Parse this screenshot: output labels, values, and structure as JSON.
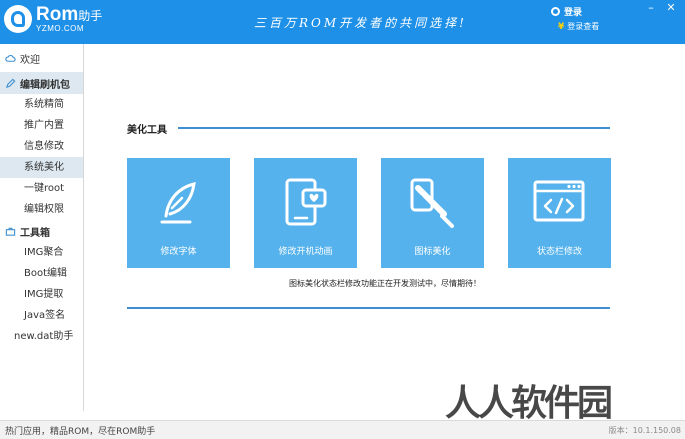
{
  "titlebar": {
    "logo_name": "Rom",
    "logo_name_suffix": "助手",
    "logo_domain": "YZMO.COM",
    "slogan": "三百万ROM开发者的共同选择!",
    "login_label": "登录",
    "gift_label": "登录查看",
    "min_button": "–",
    "close_button": "✕"
  },
  "sidebar": {
    "welcome": "欢迎",
    "group_edit": "编辑刷机包",
    "edit_items": [
      "系统精简",
      "推广内置",
      "信息修改",
      "系统美化",
      "一键root",
      "编辑权限"
    ],
    "selected_item": "系统美化",
    "group_tools": "工具箱",
    "tool_items": [
      "IMG聚合",
      "Boot编辑",
      "IMG提取",
      "Java签名",
      "new.dat助手"
    ]
  },
  "main": {
    "section_title": "美化工具",
    "tiles": [
      {
        "label": "修改字体",
        "icon": "feather-icon"
      },
      {
        "label": "修改开机动画",
        "icon": "phone-heart-icon"
      },
      {
        "label": "图标美化",
        "icon": "brush-icon"
      },
      {
        "label": "状态栏修改",
        "icon": "code-window-icon"
      }
    ],
    "notice": "图标美化状态栏修改功能正在开发测试中，尽情期待！"
  },
  "statusbar": {
    "text": "热门应用，精品ROM，尽在ROM助手",
    "version": "版本：10.1.150.08"
  },
  "watermark": "人人软件园",
  "colors": {
    "titlebar": "#1e90e8",
    "tile": "#55b2ec",
    "accent_line": "#3d8fd1",
    "sidebar_selected": "#dde8f0"
  }
}
